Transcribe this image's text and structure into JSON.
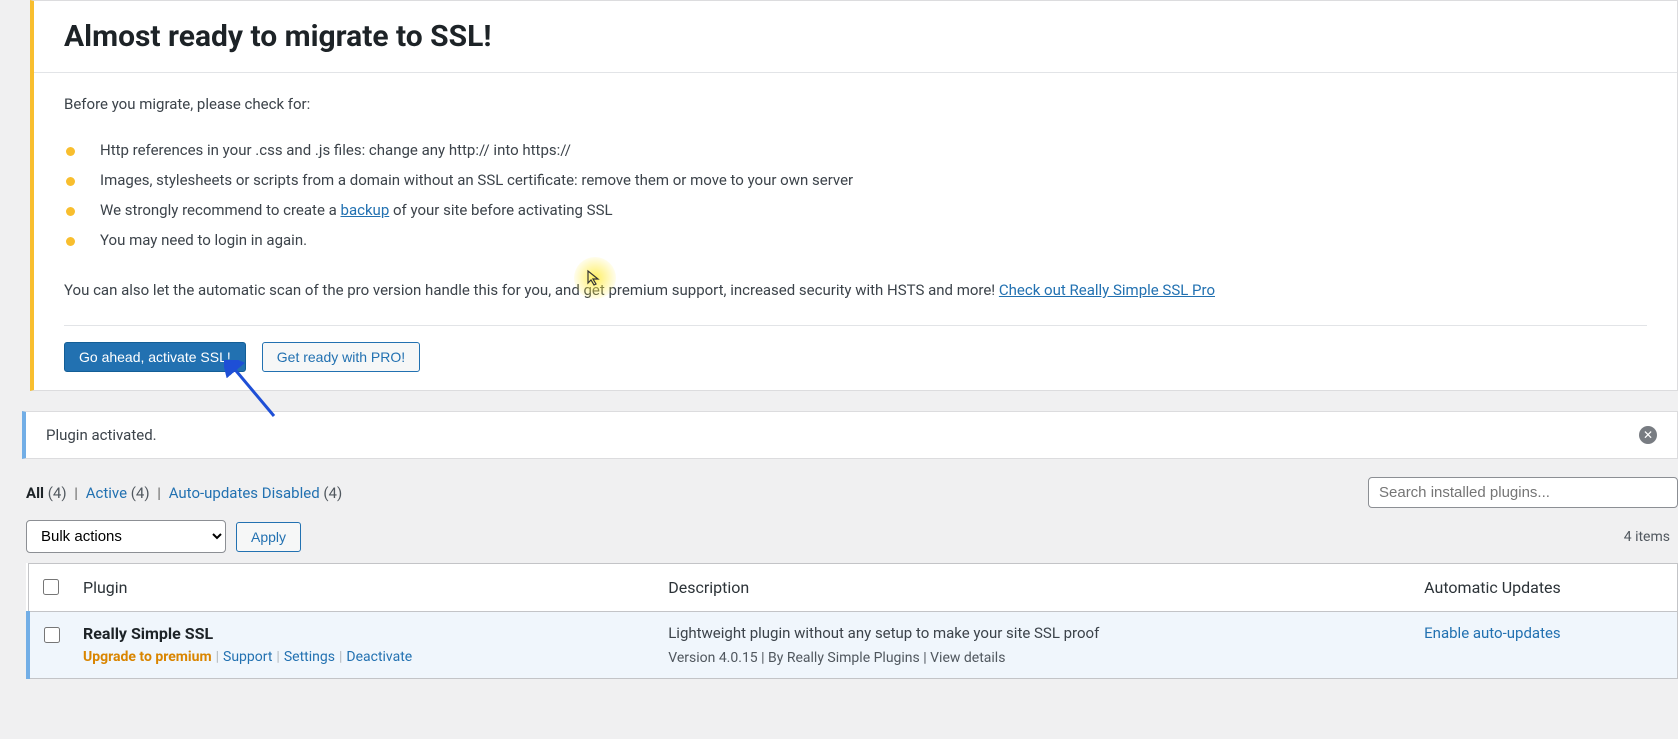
{
  "notice": {
    "title": "Almost ready to migrate to SSL!",
    "intro": "Before you migrate, please check for:",
    "items": [
      "Http references in your .css and .js files: change any http:// into https://",
      "Images, stylesheets or scripts from a domain without an SSL certificate: remove them or move to your own server",
      "We strongly recommend to create a ",
      "You may need to login in again."
    ],
    "backup_link": "backup",
    "backup_suffix": " of your site before activating SSL",
    "pro_prefix": "You can also let the automatic scan of the pro version handle this for you, and get premium support, increased security with HSTS and more! ",
    "pro_link": "Check out Really Simple SSL Pro",
    "btn_primary": "Go ahead, activate SSL!",
    "btn_secondary": "Get ready with PRO!"
  },
  "status": {
    "message": "Plugin activated."
  },
  "filters": {
    "all_label": "All",
    "all_count": "(4)",
    "active_label": "Active",
    "active_count": "(4)",
    "auto_label": "Auto-updates Disabled",
    "auto_count": "(4)"
  },
  "search": {
    "placeholder": "Search installed plugins..."
  },
  "bulk": {
    "label": "Bulk actions",
    "apply": "Apply"
  },
  "items_count": "4 items",
  "table": {
    "col_plugin": "Plugin",
    "col_desc": "Description",
    "col_auto": "Automatic Updates"
  },
  "plugin": {
    "name": "Really Simple SSL",
    "upgrade": "Upgrade to premium",
    "support": "Support",
    "settings": "Settings",
    "deactivate": "Deactivate",
    "desc": "Lightweight plugin without any setup to make your site SSL proof",
    "meta_prefix": "Version 4.0.15 | By ",
    "meta_author": "Really Simple Plugins",
    "meta_sep": " | ",
    "meta_view": "View details",
    "auto_link": "Enable auto-updates"
  }
}
